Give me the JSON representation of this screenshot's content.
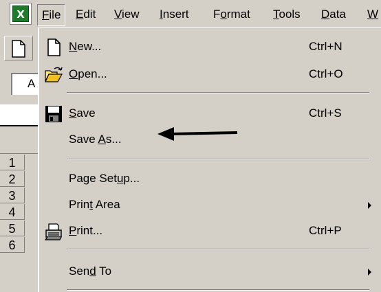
{
  "menubar": {
    "items": [
      {
        "label": "File",
        "key": "F",
        "rest": "ile"
      },
      {
        "label": "Edit",
        "key": "E",
        "rest": "dit"
      },
      {
        "label": "View",
        "key": "V",
        "rest": "iew"
      },
      {
        "label": "Insert",
        "key": "I",
        "rest": "nsert"
      },
      {
        "label": "Format",
        "pre": "F",
        "key": "o",
        "rest": "rmat"
      },
      {
        "label": "Tools",
        "key": "T",
        "rest": "ools"
      },
      {
        "label": "Data",
        "key": "D",
        "rest": "ata"
      },
      {
        "label": "W",
        "key": "W",
        "rest": ""
      }
    ]
  },
  "sheet": {
    "namebox_text": "A",
    "row_headers": [
      "1",
      "2",
      "3",
      "4",
      "5",
      "6"
    ]
  },
  "file_menu": {
    "items": [
      {
        "pre": "",
        "key": "N",
        "rest": "ew...",
        "shortcut": "Ctrl+N",
        "icon": "new-document-icon"
      },
      {
        "pre": "",
        "key": "O",
        "rest": "pen...",
        "shortcut": "Ctrl+O",
        "icon": "open-folder-icon"
      },
      {
        "pre": "",
        "key": "S",
        "rest": "ave",
        "shortcut": "Ctrl+S",
        "icon": "floppy-disk-icon"
      },
      {
        "pre": "Save ",
        "key": "A",
        "rest": "s...",
        "shortcut": "",
        "icon": ""
      },
      {
        "pre": "Page Set",
        "key": "u",
        "rest": "p...",
        "shortcut": "",
        "icon": ""
      },
      {
        "pre": "Prin",
        "key": "t",
        "rest": " Area",
        "shortcut": "",
        "icon": "",
        "submenu": true
      },
      {
        "pre": "",
        "key": "P",
        "rest": "rint...",
        "shortcut": "Ctrl+P",
        "icon": "printer-icon"
      },
      {
        "pre": "Sen",
        "key": "d",
        "rest": " To",
        "shortcut": "",
        "icon": "",
        "submenu": true
      }
    ]
  },
  "colors": {
    "face": "#d4d0c8",
    "shadow": "#808080",
    "highlight": "#ffffff",
    "excel_green": "#1f7a2e"
  }
}
